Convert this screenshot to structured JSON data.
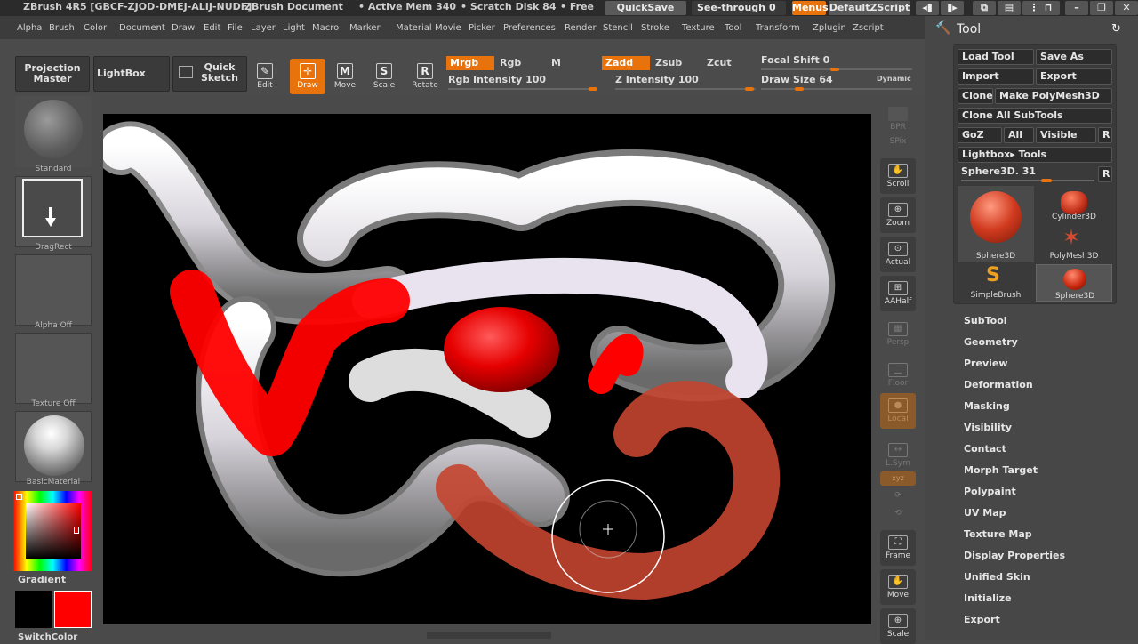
{
  "titlebar": {
    "app": "ZBrush 4R5 [GBCF-ZJOD-DMEJ-ALIJ-NUDF]",
    "document": "ZBrush Document",
    "active_mem": "• Active Mem 340",
    "scratch": "• Scratch Disk 84",
    "free": "• Free",
    "quicksave": "QuickSave",
    "see_through": "See-through",
    "see_through_value": "0",
    "menus": "Menus",
    "script": "DefaultZScript"
  },
  "menubar": [
    "Alpha",
    "Brush",
    "Color",
    "Document",
    "Draw",
    "Edit",
    "File",
    "Layer",
    "Light",
    "Macro",
    "Marker",
    "Material",
    "Movie",
    "Picker",
    "Preferences",
    "Render",
    "Stencil",
    "Stroke",
    "Texture",
    "Tool",
    "Transform",
    "Zplugin",
    "Zscript"
  ],
  "toolbar": {
    "projection_master": [
      "Projection",
      "Master"
    ],
    "lightbox": "LightBox",
    "quick_sketch": [
      "Quick",
      "Sketch"
    ],
    "modes": [
      {
        "label": "Edit",
        "icon": "edit-icon",
        "glyph": "✎"
      },
      {
        "label": "Draw",
        "icon": "draw-icon",
        "glyph": "✛"
      },
      {
        "label": "Move",
        "icon": "move-icon",
        "glyph": "M"
      },
      {
        "label": "Scale",
        "icon": "scale-icon",
        "glyph": "S"
      },
      {
        "label": "Rotate",
        "icon": "rotate-icon",
        "glyph": "R"
      }
    ],
    "mrgb": "Mrgb",
    "rgb": "Rgb",
    "m": "M",
    "zadd": "Zadd",
    "zsub": "Zsub",
    "zcut": "Zcut",
    "rgb_intensity_label": "Rgb Intensity",
    "rgb_intensity": "100",
    "z_intensity_label": "Z Intensity",
    "z_intensity": "100",
    "focal_shift_label": "Focal Shift",
    "focal_shift": "0",
    "draw_size_label": "Draw Size",
    "draw_size": "64",
    "dynamic": "Dynamic"
  },
  "leftpanel": {
    "brush": "Standard",
    "stroke": "DragRect",
    "alpha": "Alpha Off",
    "texture": "Texture Off",
    "material": "BasicMaterial",
    "gradient": "Gradient",
    "switchcolor": "SwitchColor"
  },
  "shelf": {
    "bpr": "BPR",
    "spix": "SPix",
    "scroll": "Scroll",
    "zoom": "Zoom",
    "actual": "Actual",
    "aahalf": "AAHalf",
    "persp": "Persp",
    "floor": "Floor",
    "local": "Local",
    "lsym": "L.Sym",
    "xyz": "xyz",
    "frame": "Frame",
    "move": "Move",
    "scale": "Scale"
  },
  "toolpanel": {
    "title": "Tool",
    "load_tool": "Load Tool",
    "save_as": "Save As",
    "import": "Import",
    "export": "Export",
    "clone": "Clone",
    "make_polymesh": "Make PolyMesh3D",
    "clone_all": "Clone All SubTools",
    "goz": "GoZ",
    "all": "All",
    "visible": "Visible",
    "r": "R",
    "lightbox_tools": "Lightbox▸ Tools",
    "current_tool": "Sphere3D. 31",
    "thumbs": [
      "Sphere3D",
      "Cylinder3D",
      "PolyMesh3D",
      "SimpleBrush",
      "Sphere3D"
    ]
  },
  "traymenu": [
    "SubTool",
    "Geometry",
    "Preview",
    "Deformation",
    "Masking",
    "Visibility",
    "Contact",
    "Morph Target",
    "Polypaint",
    "UV Map",
    "Texture Map",
    "Display Properties",
    "Unified Skin",
    "Initialize",
    "Export"
  ],
  "colors": {
    "accent": "#e8720c",
    "primary": "#000000",
    "secondary": "#ff0000"
  }
}
